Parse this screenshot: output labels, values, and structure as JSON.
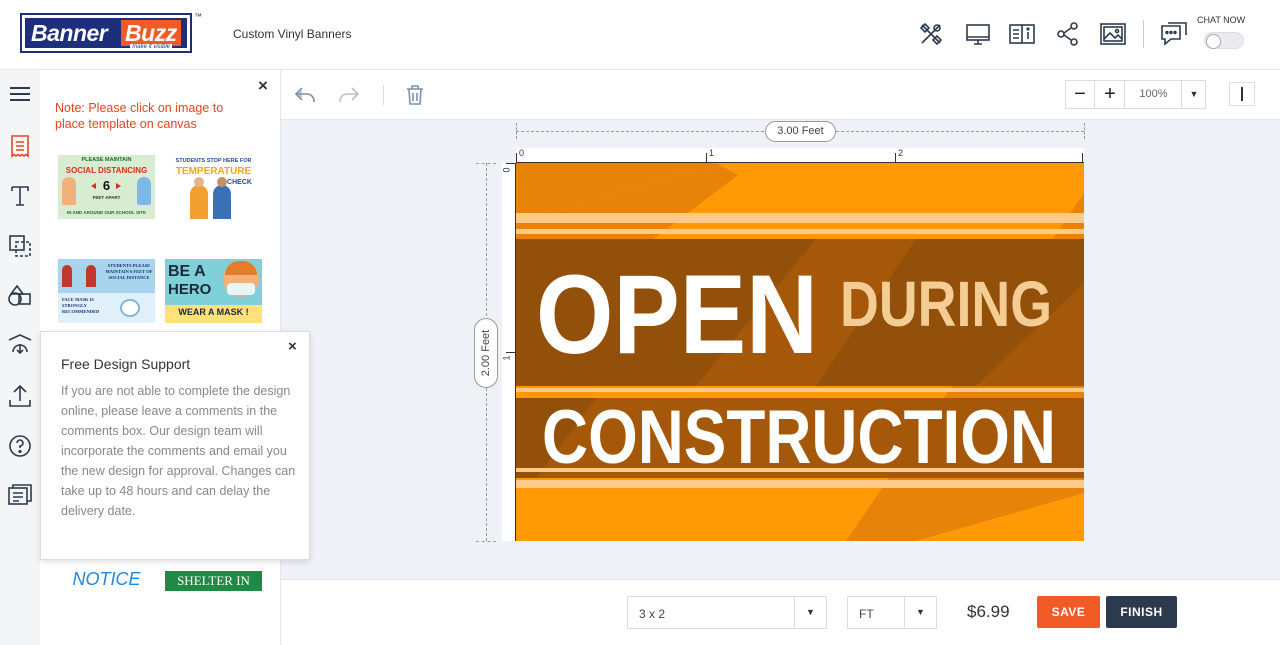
{
  "header": {
    "logo_part1": "Banner",
    "logo_part2": "Buzz",
    "logo_tagline": "make it visible",
    "logo_tm": "™",
    "page_title": "Custom Vinyl Banners",
    "chat_label": "CHAT NOW",
    "icons": [
      "tools-icon",
      "monitor-icon",
      "book-info-icon",
      "share-icon",
      "image-icon",
      "chat-icon"
    ]
  },
  "rail": {
    "items": [
      "menu-icon",
      "templates-icon",
      "text-icon",
      "shapes-icon",
      "cliparts-icon",
      "background-icon",
      "upload-icon",
      "help-icon",
      "comments-icon"
    ]
  },
  "templates": {
    "close": "×",
    "note": "Note: Please click on image to place template on canvas",
    "thumbs": [
      {
        "l1": "PLEASE MAINTAIN",
        "l2": "SOCIAL DISTANCING",
        "l3": "6",
        "l4": "FEET APART",
        "l5": "IN AND AROUND OUR SCHOOL SITE"
      },
      {
        "l1": "STUDENTS STOP HERE FOR",
        "l2": "TEMPERATURE",
        "l3": "CHECK"
      },
      {
        "l1": "STUDENTS PLEASE MAINTAIN 6 FEET OF SOCIAL DISTANCE",
        "l2": "FACE MASK IS STRONGLY RECOMMENDED"
      },
      {
        "l1": "BE A",
        "l2": "HERO",
        "l3": "WEAR A MASK !"
      },
      {
        "l1": "NOTICE"
      },
      {
        "l1": "SHELTER IN PLACE"
      }
    ]
  },
  "support": {
    "title": "Free Design Support",
    "close": "×",
    "text": "If you are not able to complete the design online, please leave a comments in the comments box. Our design team will incorporate the comments and email you the new design for approval. Changes can take up to 48 hours and can delay the delivery date."
  },
  "toolbar": {
    "zoom_minus": "−",
    "zoom_plus": "+",
    "zoom_value": "100%",
    "caret": "▼"
  },
  "canvas": {
    "width_label": "3.00 Feet",
    "height_label": "2.00 Feet",
    "ruler_top": [
      "0",
      "1",
      "2"
    ],
    "ruler_left": [
      "0",
      "1"
    ],
    "banner": {
      "word1": "OPEN",
      "word2": "DURING",
      "word3": "CONSTRUCTION",
      "colors": {
        "orange": "#ff9a06",
        "brown": "#a5580a",
        "stripe": "#ffc98a",
        "text": "#ffffff",
        "subtext": "#f3cd94"
      }
    }
  },
  "footer": {
    "size_value": "3 x 2",
    "unit_value": "FT",
    "caret": "▼",
    "price": "$6.99",
    "save": "SAVE",
    "finish": "FINISH"
  }
}
